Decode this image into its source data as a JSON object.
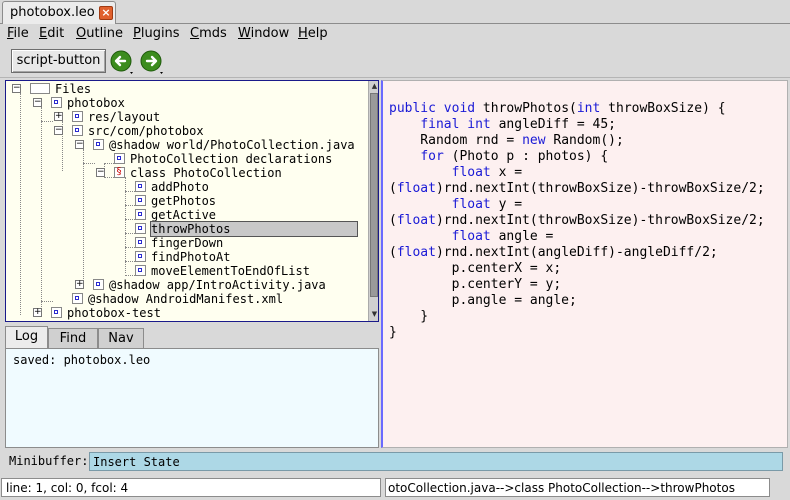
{
  "window": {
    "tab_label": "photobox.leo",
    "close_glyph": "×"
  },
  "menu": {
    "items": [
      {
        "first": "F",
        "rest": "ile"
      },
      {
        "first": "E",
        "rest": "dit"
      },
      {
        "first": "O",
        "rest": "utline"
      },
      {
        "first": "P",
        "rest": "lugins"
      },
      {
        "first": "C",
        "rest": "mds"
      },
      {
        "first": "W",
        "rest": "indow"
      },
      {
        "first": "H",
        "rest": "elp"
      }
    ]
  },
  "toolbar": {
    "script_button_label": "script-button",
    "back_icon": "go-back-icon",
    "forward_icon": "go-forward-icon",
    "accent_green": "#3c8c1e"
  },
  "outline": {
    "nodes": [
      {
        "label": "Files"
      },
      {
        "label": "photobox"
      },
      {
        "label": "res/layout"
      },
      {
        "label": "src/com/photobox"
      },
      {
        "label": "@shadow world/PhotoCollection.java"
      },
      {
        "label": "PhotoCollection declarations"
      },
      {
        "label": "class PhotoCollection"
      },
      {
        "label": "addPhoto"
      },
      {
        "label": "getPhotos"
      },
      {
        "label": "getActive"
      },
      {
        "label": "throwPhotos"
      },
      {
        "label": "fingerDown"
      },
      {
        "label": "findPhotoAt"
      },
      {
        "label": "moveElementToEndOfList"
      },
      {
        "label": "@shadow app/IntroActivity.java"
      },
      {
        "label": "@shadow AndroidManifest.xml"
      },
      {
        "label": "photobox-test"
      }
    ],
    "selected": "throwPhotos"
  },
  "log": {
    "tabs": [
      "Log",
      "Find",
      "Nav"
    ],
    "active_tab": "Log",
    "text": "saved: photobox.leo"
  },
  "body": {
    "code": [
      "public void throwPhotos(int throwBoxSize) {",
      "    final int angleDiff = 45;",
      "    Random rnd = new Random();",
      "    for (Photo p : photos) {",
      "        float x =",
      "(float)rnd.nextInt(throwBoxSize)-throwBoxSize/2;",
      "        float y =",
      "(float)rnd.nextInt(throwBoxSize)-throwBoxSize/2;",
      "        float angle =",
      "(float)rnd.nextInt(angleDiff)-angleDiff/2;",
      "        p.centerX = x;",
      "        p.centerY = y;",
      "        p.angle = angle;",
      "    }",
      "}"
    ]
  },
  "minibuffer": {
    "label": "Minibuffer:",
    "value": "Insert State"
  },
  "status": {
    "position": "line: 1, col: 0, fcol: 4",
    "path": "otoCollection.java-->class PhotoCollection-->throwPhotos"
  },
  "colors": {
    "outline_bg": "#fffff0",
    "body_bg": "#fdf0f0",
    "log_bg": "#f0fbff",
    "minibuffer_bg": "#add8e6",
    "keyword": "#1a1ad6"
  }
}
